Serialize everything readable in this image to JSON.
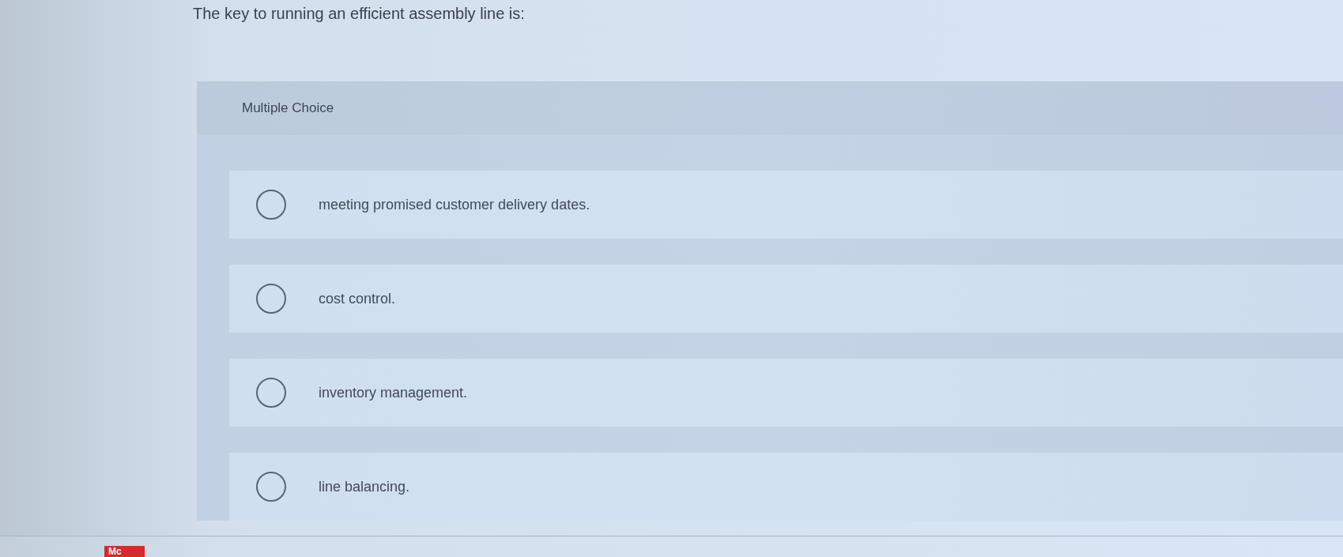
{
  "question": {
    "text": "The key to running an efficient assembly line is:"
  },
  "panel": {
    "type_label": "Multiple Choice",
    "options": [
      {
        "text": "meeting promised customer delivery dates.",
        "selected": false
      },
      {
        "text": "cost control.",
        "selected": false
      },
      {
        "text": "inventory management.",
        "selected": false
      },
      {
        "text": "line balancing.",
        "selected": false
      }
    ]
  },
  "footer": {
    "logo": "Mc"
  }
}
